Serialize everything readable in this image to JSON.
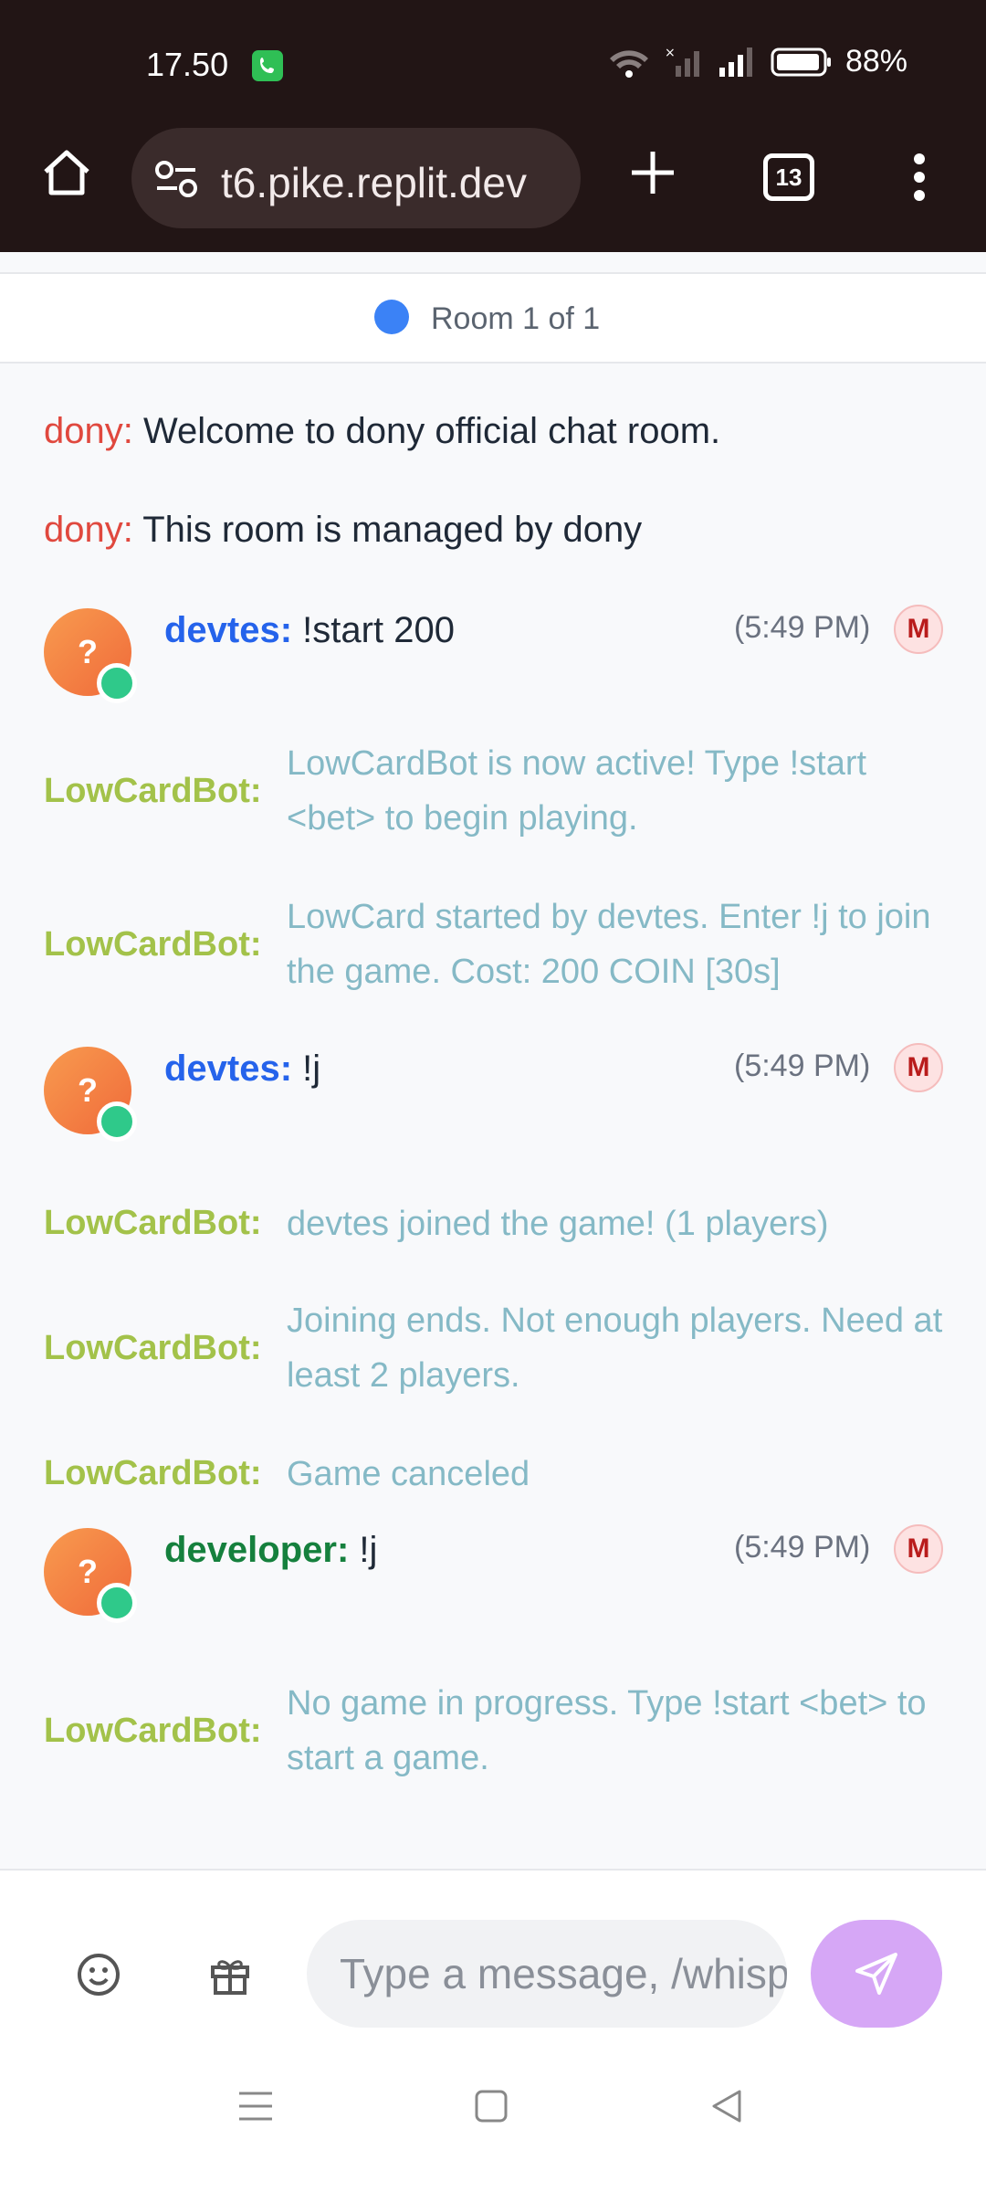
{
  "status_bar": {
    "time": "17.50",
    "battery": "88%"
  },
  "browser": {
    "url": "t6.pike.replit.dev",
    "tab_count": "13"
  },
  "room": {
    "label": "Room 1 of 1"
  },
  "messages": {
    "sys1": {
      "user": "dony:",
      "text": " Welcome to dony official chat room."
    },
    "sys2": {
      "user": "dony:",
      "text": " This room is managed by dony"
    },
    "u1": {
      "user": "devtes:",
      "text": " !start 200",
      "time": "(5:49 PM)",
      "badge": "M",
      "avatar": "?"
    },
    "b1": {
      "user": "LowCardBot:",
      "text": "LowCardBot is now active! Type !start <bet> to begin playing."
    },
    "b2": {
      "user": "LowCardBot:",
      "text": "LowCard started by devtes. Enter !j to join the game. Cost: 200 COIN [30s]"
    },
    "u2": {
      "user": "devtes:",
      "text": " !j",
      "time": "(5:49 PM)",
      "badge": "M",
      "avatar": "?"
    },
    "b3": {
      "user": "LowCardBot:",
      "text": "devtes joined the game! (1 players)"
    },
    "b4": {
      "user": "LowCardBot:",
      "text": "Joining ends. Not enough players. Need at least 2 players."
    },
    "b5": {
      "user": "LowCardBot:",
      "text": "Game canceled"
    },
    "u3": {
      "user": "developer:",
      "text": " !j",
      "time": "(5:49 PM)",
      "badge": "M",
      "avatar": "?"
    },
    "b6": {
      "user": "LowCardBot:",
      "text": "No game in progress. Type !start <bet> to start a game."
    }
  },
  "input": {
    "placeholder": "Type a message, /whisper"
  },
  "colors": {
    "bot": "#a3c24a",
    "bot_text": "#85b9c6",
    "devtes": "#2563eb",
    "developer": "#15803d",
    "system_user": "#e0483e",
    "send": "#d6a7f6"
  }
}
